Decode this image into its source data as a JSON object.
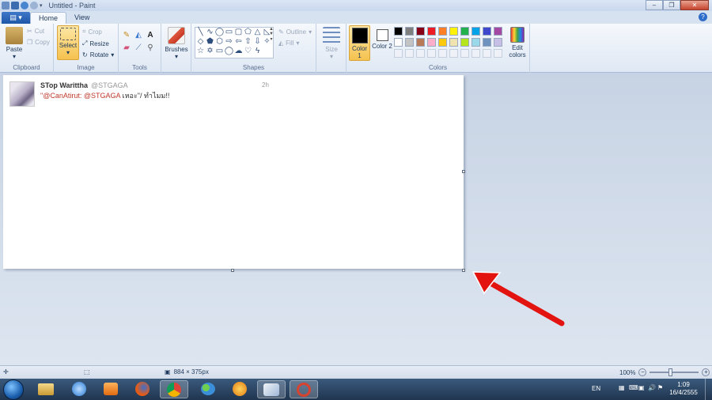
{
  "window": {
    "title": "Untitled - Paint",
    "controls": [
      "minimize",
      "maximize",
      "close"
    ]
  },
  "tabs": {
    "file": "",
    "home": "Home",
    "view": "View"
  },
  "ribbon": {
    "clipboard": {
      "label": "Clipboard",
      "paste": "Paste",
      "cut": "Cut",
      "copy": "Copy"
    },
    "image": {
      "label": "Image",
      "select": "Select",
      "crop": "Crop",
      "resize": "Resize",
      "rotate": "Rotate"
    },
    "tools": {
      "label": "Tools"
    },
    "brushes": {
      "label": "Brushes"
    },
    "shapes": {
      "label": "Shapes",
      "outline": "Outline",
      "fill": "Fill"
    },
    "size": {
      "label": "Size"
    },
    "colors": {
      "label": "Colors",
      "color1": "Color 1",
      "color1_value": "#000000",
      "color2": "Color 2",
      "color2_value": "#ffffff",
      "edit": "Edit colors",
      "palette_row1": [
        "#000000",
        "#7f7f7f",
        "#880015",
        "#ed1c24",
        "#ff7f27",
        "#fff200",
        "#22b14c",
        "#00a2e8",
        "#3f48cc",
        "#a349a4"
      ],
      "palette_row2": [
        "#ffffff",
        "#c3c3c3",
        "#b97a57",
        "#ffaec9",
        "#ffc90e",
        "#efe4b0",
        "#b5e61d",
        "#99d9ea",
        "#7092be",
        "#c8bfe7"
      ]
    }
  },
  "canvas": {
    "tweet": {
      "name": "STop Warittha",
      "handle": "@STGAGA",
      "time": "2h",
      "quote_open": "\"",
      "mention1": "@CanAtirut",
      "sep": ": ",
      "mention2": "@STGAGA",
      "text": " เหอะ\"/ ทำไมม!!"
    }
  },
  "statusbar": {
    "dimensions": "884 × 375px",
    "zoom": "100%"
  },
  "taskbar": {
    "lang": "EN",
    "time": "1:09",
    "date": "16/4/2555"
  }
}
